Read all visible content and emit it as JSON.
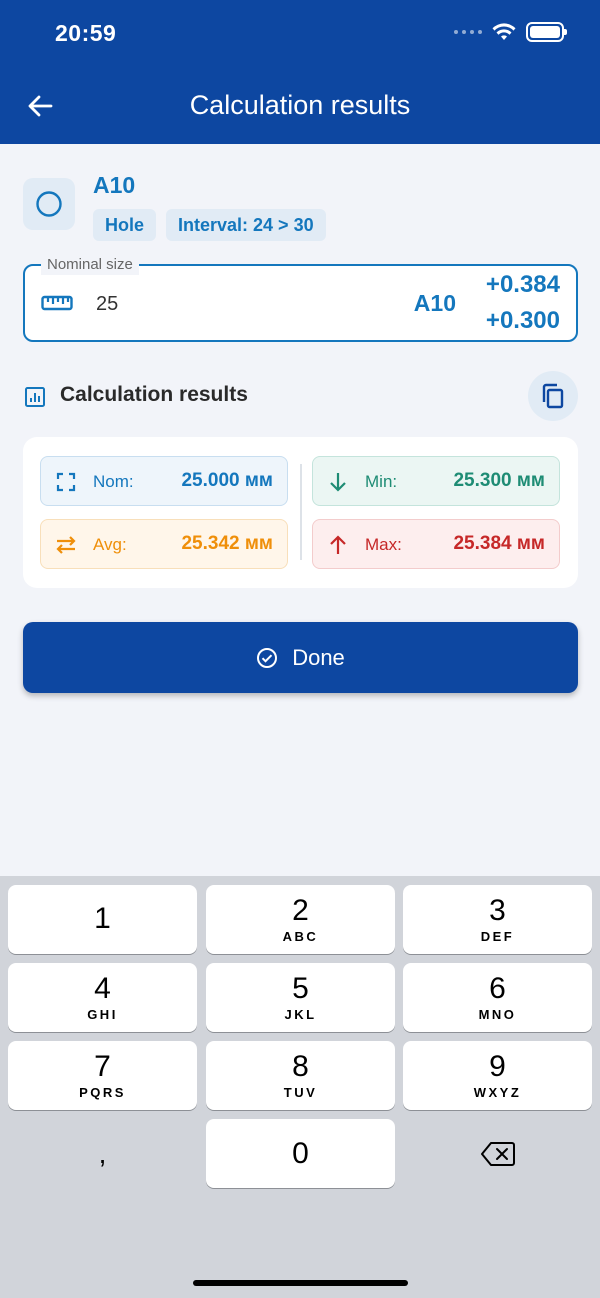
{
  "status_bar": {
    "time": "20:59"
  },
  "header": {
    "title": "Calculation results",
    "back_icon": "arrow-left-icon"
  },
  "tolerance": {
    "name": "A10",
    "icon": "circle-hole-icon",
    "chips": [
      "Hole",
      "Interval: 24 > 30"
    ]
  },
  "nominal_field": {
    "label": "Nominal size",
    "value": "25",
    "code": "A10",
    "upper_deviation": "+0.384",
    "lower_deviation": "+0.300"
  },
  "results_section": {
    "title": "Calculation results",
    "items": {
      "nom": {
        "label": "Nom:",
        "value": "25.000 мм"
      },
      "avg": {
        "label": "Avg:",
        "value": "25.342 мм"
      },
      "min": {
        "label": "Min:",
        "value": "25.300 мм"
      },
      "max": {
        "label": "Max:",
        "value": "25.384 мм"
      }
    }
  },
  "done_button": {
    "label": "Done"
  },
  "keyboard": {
    "keys": [
      {
        "num": "1",
        "letters": ""
      },
      {
        "num": "2",
        "letters": "ABC"
      },
      {
        "num": "3",
        "letters": "DEF"
      },
      {
        "num": "4",
        "letters": "GHI"
      },
      {
        "num": "5",
        "letters": "JKL"
      },
      {
        "num": "6",
        "letters": "MNO"
      },
      {
        "num": "7",
        "letters": "PQRS"
      },
      {
        "num": "8",
        "letters": "TUV"
      },
      {
        "num": "9",
        "letters": "WXYZ"
      },
      {
        "num": "0",
        "letters": ""
      }
    ],
    "comma": ","
  },
  "colors": {
    "primary": "#0d47a1",
    "accent": "#1477bd",
    "avg": "#ef8f0a",
    "min": "#1e8c74",
    "max": "#c62828"
  }
}
